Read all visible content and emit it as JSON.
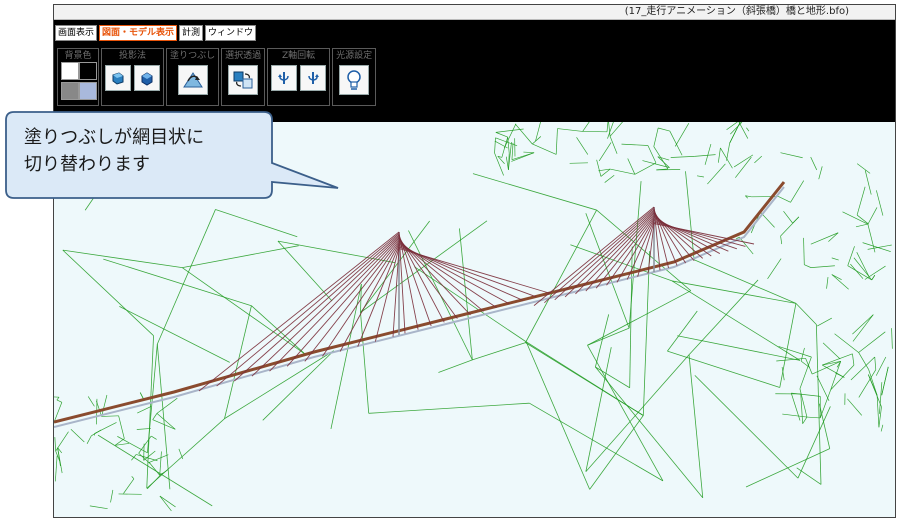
{
  "window": {
    "title": "(17_走行アニメーション（斜張橋）橋と地形.bfo)"
  },
  "menu": {
    "tabs": [
      {
        "label": "画面表示",
        "active": false
      },
      {
        "label": "図面・モデル表示",
        "active": true
      },
      {
        "label": "計測",
        "active": false
      },
      {
        "label": "ウィンドウ",
        "active": false
      }
    ]
  },
  "toolbar": {
    "groups": [
      {
        "label": "背景色"
      },
      {
        "label": "投影法"
      },
      {
        "label": "塗りつぶし"
      },
      {
        "label": "選択透過"
      },
      {
        "label": "Z軸回転"
      },
      {
        "label": "光源設定"
      }
    ],
    "background_swatches": [
      "#ffffff",
      "#000000",
      "#888888",
      "#a9b9dc"
    ]
  },
  "callout": {
    "line1": "塗りつぶしが網目状に",
    "line2": "切り替わります"
  },
  "colors": {
    "mesh": "#1e9a1e",
    "bridge_deck": "#8a4b2e",
    "cables": "#7a2e3a",
    "viewport_bg": "#eef9fb",
    "accent": "#e8540a"
  }
}
